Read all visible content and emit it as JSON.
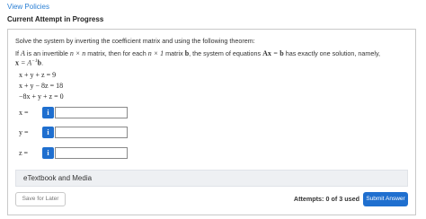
{
  "header": {
    "view_policies_label": "View Policies",
    "attempt_heading": "Current Attempt in Progress"
  },
  "question": {
    "instruction": "Solve the system by inverting the coefficient matrix and using the following theorem:",
    "theorem": {
      "p1": "If ",
      "A": "A",
      "p2": " is an invertible ",
      "nxn": "n × n",
      "p3": " matrix, then for each ",
      "nx1": "n × 1",
      "p4": " matrix ",
      "b": "b",
      "p5": ", the system of equations ",
      "Ax": "Ax",
      "p6": " = ",
      "b2": "b",
      "p7": " has exactly one solution, namely,",
      "x": "x",
      "p8": " = ",
      "Ainv": "A",
      "inv_exp": "−1",
      "b3": "b",
      "p9": "."
    },
    "equations": [
      "x + y + z = 9",
      "x + y − 8z = 18",
      "−8x + y + z = 0"
    ]
  },
  "answers": [
    {
      "label": "x =",
      "info": "i",
      "value": ""
    },
    {
      "label": "y =",
      "info": "i",
      "value": ""
    },
    {
      "label": "z =",
      "info": "i",
      "value": ""
    }
  ],
  "etextbook": {
    "label": "eTextbook and Media"
  },
  "footer": {
    "save_label": "Save for Later",
    "attempts_text": "Attempts: 0 of 3 used",
    "submit_label": "Submit Answer"
  },
  "colors": {
    "accent": "#1f6fcf",
    "link": "#2a7fd4"
  }
}
